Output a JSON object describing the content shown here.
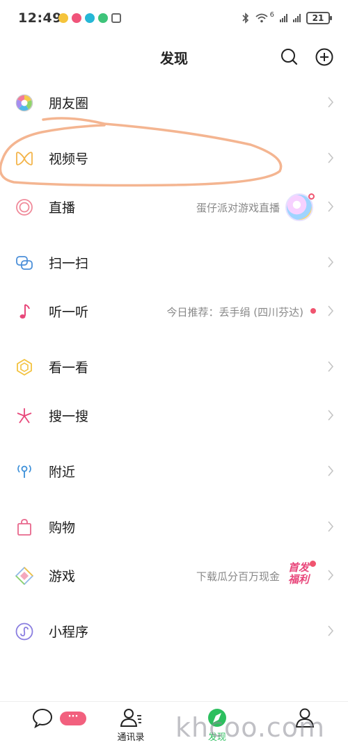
{
  "status_bar": {
    "time": "12:49",
    "battery": "21",
    "network": "6"
  },
  "header": {
    "title": "发现",
    "search_icon": "search-icon",
    "add_icon": "plus-circle-icon"
  },
  "menu": [
    {
      "id": "moments",
      "label": "朋友圈",
      "icon": "moments-aperture-icon"
    },
    {
      "id": "channels",
      "label": "视频号",
      "icon": "channels-butterfly-icon"
    },
    {
      "id": "live",
      "label": "直播",
      "icon": "live-rings-icon",
      "extra": "蛋仔派对游戏直播"
    },
    {
      "id": "scan",
      "label": "扫一扫",
      "icon": "scan-icon"
    },
    {
      "id": "listen",
      "label": "听一听",
      "icon": "music-note-icon",
      "extra": "今日推荐：丢手绢 (四川芬达)"
    },
    {
      "id": "top-stories",
      "label": "看一看",
      "icon": "top-stories-icon"
    },
    {
      "id": "search",
      "label": "搜一搜",
      "icon": "search-star-icon"
    },
    {
      "id": "nearby",
      "label": "附近",
      "icon": "nearby-pin-icon"
    },
    {
      "id": "shopping",
      "label": "购物",
      "icon": "shopping-bag-icon"
    },
    {
      "id": "games",
      "label": "游戏",
      "icon": "games-diamond-icon",
      "extra": "下载瓜分百万现金",
      "promo": "首发福利"
    },
    {
      "id": "mini-programs",
      "label": "小程序",
      "icon": "mini-program-icon"
    }
  ],
  "tab_bar": {
    "tabs": [
      {
        "id": "chats",
        "label": "",
        "icon": "chat-bubble-icon",
        "badge": "···"
      },
      {
        "id": "contacts",
        "label": "通讯录",
        "icon": "contacts-icon"
      },
      {
        "id": "discover",
        "label": "发现",
        "icon": "compass-icon",
        "active": true
      },
      {
        "id": "me",
        "label": "",
        "icon": "person-icon"
      }
    ]
  },
  "watermark": "khcoo.com",
  "colors": {
    "accent_green": "#2cbf5e",
    "badge_red": "#f0546f",
    "annotation_orange": "#f4b591"
  }
}
